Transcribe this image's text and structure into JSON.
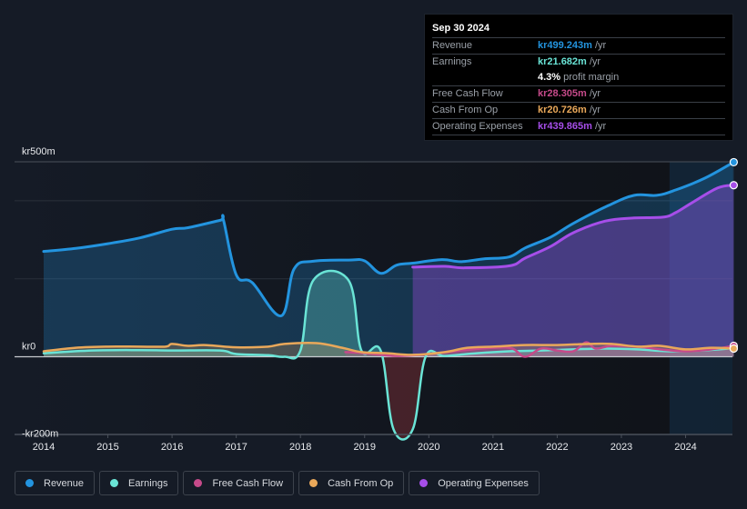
{
  "tooltip": {
    "date": "Sep 30 2024",
    "rows": [
      {
        "label": "Revenue",
        "value": "kr499.243m",
        "unit": "/yr",
        "color": "#2394df"
      },
      {
        "label": "Earnings",
        "value": "kr21.682m",
        "unit": "/yr",
        "color": "#6ae4d6"
      },
      {
        "label": "",
        "value": "4.3%",
        "unit": "profit margin",
        "color": "#ffffff"
      },
      {
        "label": "Free Cash Flow",
        "value": "kr28.305m",
        "unit": "/yr",
        "color": "#c64a8a"
      },
      {
        "label": "Cash From Op",
        "value": "kr20.726m",
        "unit": "/yr",
        "color": "#e9a85a"
      },
      {
        "label": "Operating Expenses",
        "value": "kr439.865m",
        "unit": "/yr",
        "color": "#a64ee9"
      }
    ]
  },
  "legend": [
    {
      "label": "Revenue",
      "color": "#2394df"
    },
    {
      "label": "Earnings",
      "color": "#6ae4d6"
    },
    {
      "label": "Free Cash Flow",
      "color": "#c64a8a"
    },
    {
      "label": "Cash From Op",
      "color": "#e9a85a"
    },
    {
      "label": "Operating Expenses",
      "color": "#a64ee9"
    }
  ],
  "chart_data": {
    "type": "area",
    "title": "",
    "xlabel": "",
    "ylabel": "",
    "currency_prefix": "kr",
    "ylim": [
      -200,
      500
    ],
    "xlim": [
      2013.6,
      2024.75
    ],
    "y_tick_labels": [
      {
        "value": 500,
        "label": "kr500m"
      },
      {
        "value": 0,
        "label": "kr0"
      },
      {
        "value": -200,
        "label": "-kr200m"
      }
    ],
    "gridlines": [
      500,
      400,
      200
    ],
    "x_tick_labels": [
      "2014",
      "2015",
      "2016",
      "2017",
      "2018",
      "2019",
      "2020",
      "2021",
      "2022",
      "2023",
      "2024"
    ],
    "x_ticks": [
      2014,
      2015,
      2016,
      2017,
      2018,
      2019,
      2020,
      2021,
      2022,
      2023,
      2024
    ],
    "highlight_range": [
      2023.75,
      2024.75
    ],
    "series": [
      {
        "name": "Revenue",
        "color": "#2394df",
        "points": [
          [
            2014.0,
            270
          ],
          [
            2014.5,
            278
          ],
          [
            2015.0,
            290
          ],
          [
            2015.5,
            305
          ],
          [
            2016.0,
            327
          ],
          [
            2016.25,
            331
          ],
          [
            2016.75,
            350
          ],
          [
            2016.8,
            351
          ],
          [
            2017.0,
            210
          ],
          [
            2017.25,
            190
          ],
          [
            2017.7,
            105
          ],
          [
            2017.9,
            225
          ],
          [
            2018.2,
            245
          ],
          [
            2018.75,
            248
          ],
          [
            2019.0,
            246
          ],
          [
            2019.25,
            214
          ],
          [
            2019.5,
            235
          ],
          [
            2019.75,
            240
          ],
          [
            2020.2,
            249
          ],
          [
            2020.5,
            244
          ],
          [
            2020.85,
            251
          ],
          [
            2021.25,
            256
          ],
          [
            2021.5,
            279
          ],
          [
            2021.9,
            307
          ],
          [
            2022.25,
            342
          ],
          [
            2022.8,
            388
          ],
          [
            2023.2,
            414
          ],
          [
            2023.55,
            414
          ],
          [
            2023.85,
            428
          ],
          [
            2024.3,
            458
          ],
          [
            2024.75,
            499
          ]
        ]
      },
      {
        "name": "Earnings",
        "color": "#6ae4d6",
        "points": [
          [
            2014.0,
            9
          ],
          [
            2014.75,
            16
          ],
          [
            2015.5,
            17
          ],
          [
            2016.0,
            16
          ],
          [
            2016.75,
            16
          ],
          [
            2017.0,
            7
          ],
          [
            2017.5,
            4
          ],
          [
            2017.75,
            0
          ],
          [
            2018.0,
            16
          ],
          [
            2018.2,
            196
          ],
          [
            2018.75,
            196
          ],
          [
            2018.95,
            16
          ],
          [
            2019.25,
            16
          ],
          [
            2019.45,
            -186
          ],
          [
            2019.75,
            -186
          ],
          [
            2019.95,
            0
          ],
          [
            2020.25,
            2
          ],
          [
            2020.75,
            9
          ],
          [
            2021.25,
            14
          ],
          [
            2021.75,
            16
          ],
          [
            2022.25,
            19
          ],
          [
            2022.75,
            21
          ],
          [
            2023.25,
            19
          ],
          [
            2023.75,
            14
          ],
          [
            2024.25,
            16
          ],
          [
            2024.75,
            22
          ]
        ]
      },
      {
        "name": "Free Cash Flow",
        "color": "#c64a8a",
        "points": [
          [
            2018.7,
            12
          ],
          [
            2019.0,
            9
          ],
          [
            2019.5,
            2
          ],
          [
            2020.0,
            7
          ],
          [
            2020.5,
            16
          ],
          [
            2021.0,
            23
          ],
          [
            2021.3,
            21
          ],
          [
            2021.5,
            0
          ],
          [
            2021.75,
            21
          ],
          [
            2022.0,
            16
          ],
          [
            2022.25,
            14
          ],
          [
            2022.45,
            37
          ],
          [
            2022.6,
            21
          ],
          [
            2022.85,
            28
          ],
          [
            2023.25,
            26
          ],
          [
            2023.6,
            19
          ],
          [
            2024.0,
            14
          ],
          [
            2024.4,
            19
          ],
          [
            2024.75,
            28
          ]
        ]
      },
      {
        "name": "Cash From Op",
        "color": "#e9a85a",
        "points": [
          [
            2014.0,
            14
          ],
          [
            2014.5,
            23
          ],
          [
            2015.0,
            26
          ],
          [
            2015.5,
            26
          ],
          [
            2015.9,
            26
          ],
          [
            2016.0,
            33
          ],
          [
            2016.25,
            28
          ],
          [
            2016.5,
            30
          ],
          [
            2016.9,
            25
          ],
          [
            2017.1,
            24
          ],
          [
            2017.5,
            26
          ],
          [
            2017.75,
            33
          ],
          [
            2018.25,
            35
          ],
          [
            2018.65,
            23
          ],
          [
            2018.95,
            12
          ],
          [
            2019.35,
            9
          ],
          [
            2019.75,
            5
          ],
          [
            2020.25,
            12
          ],
          [
            2020.6,
            23
          ],
          [
            2021.0,
            26
          ],
          [
            2021.5,
            30
          ],
          [
            2022.0,
            30
          ],
          [
            2022.5,
            33
          ],
          [
            2022.85,
            33
          ],
          [
            2023.25,
            26
          ],
          [
            2023.6,
            28
          ],
          [
            2024.0,
            19
          ],
          [
            2024.4,
            23
          ],
          [
            2024.75,
            21
          ]
        ]
      },
      {
        "name": "Operating Expenses",
        "color": "#a64ee9",
        "points": [
          [
            2019.75,
            230
          ],
          [
            2020.25,
            232
          ],
          [
            2020.55,
            228
          ],
          [
            2021.25,
            233
          ],
          [
            2021.5,
            253
          ],
          [
            2021.9,
            283
          ],
          [
            2022.25,
            318
          ],
          [
            2022.75,
            348
          ],
          [
            2023.2,
            356
          ],
          [
            2023.65,
            358
          ],
          [
            2023.85,
            370
          ],
          [
            2024.1,
            395
          ],
          [
            2024.5,
            433
          ],
          [
            2024.75,
            440
          ]
        ]
      }
    ]
  }
}
